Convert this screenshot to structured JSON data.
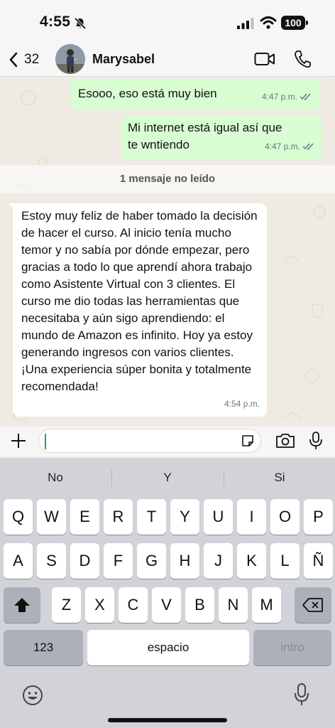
{
  "status_bar": {
    "time": "4:55",
    "battery": "100",
    "icons": [
      "bell-off-icon",
      "signal-icon",
      "wifi-icon",
      "battery-icon"
    ]
  },
  "header": {
    "back_count": "32",
    "contact_name": "Marysabel",
    "icons": [
      "chevron-left-icon",
      "video-camera-icon",
      "phone-icon"
    ]
  },
  "messages": [
    {
      "direction": "outgoing",
      "text": "Esooo, eso está muy bien",
      "time": "4:47 p.m.",
      "status": "read"
    },
    {
      "direction": "outgoing",
      "text": "Mi internet está igual así que te wntiendo",
      "time": "4:47 p.m.",
      "status": "read"
    },
    {
      "direction": "incoming",
      "text": "Estoy muy feliz de haber tomado la decisión de hacer el curso.  Al inicio tenía mucho temor y no sabía por dónde empezar, pero gracias a todo lo que aprendí ahora trabajo como Asistente Virtual con 3 clientes. El curso me dio todas las herramientas que necesitaba y aún sigo aprendiendo: el mundo de Amazon es infinito. Hoy ya estoy generando ingresos con varios clientes. ¡Una experiencia súper bonita y totalmente recomendada!",
      "time": "4:54 p.m."
    }
  ],
  "unread_divider": "1 mensaje no leído",
  "input": {
    "value": "",
    "icons": [
      "plus-icon",
      "sticker-icon",
      "camera-icon",
      "microphone-icon"
    ]
  },
  "keyboard": {
    "suggestions": [
      "No",
      "Y",
      "Si"
    ],
    "row1": [
      "Q",
      "W",
      "E",
      "R",
      "T",
      "Y",
      "U",
      "I",
      "O",
      "P"
    ],
    "row2": [
      "A",
      "S",
      "D",
      "F",
      "G",
      "H",
      "J",
      "K",
      "L",
      "Ñ"
    ],
    "row3": [
      "Z",
      "X",
      "C",
      "V",
      "B",
      "N",
      "M"
    ],
    "numbers_key": "123",
    "space_key": "espacio",
    "return_key": "intro",
    "icons": [
      "shift-icon",
      "backspace-icon",
      "emoji-icon",
      "dictation-icon"
    ]
  },
  "colors": {
    "outgoing_bubble": "#d9fdd3",
    "incoming_bubble": "#ffffff",
    "read_tick": "#667781",
    "cursor": "#25a060"
  }
}
